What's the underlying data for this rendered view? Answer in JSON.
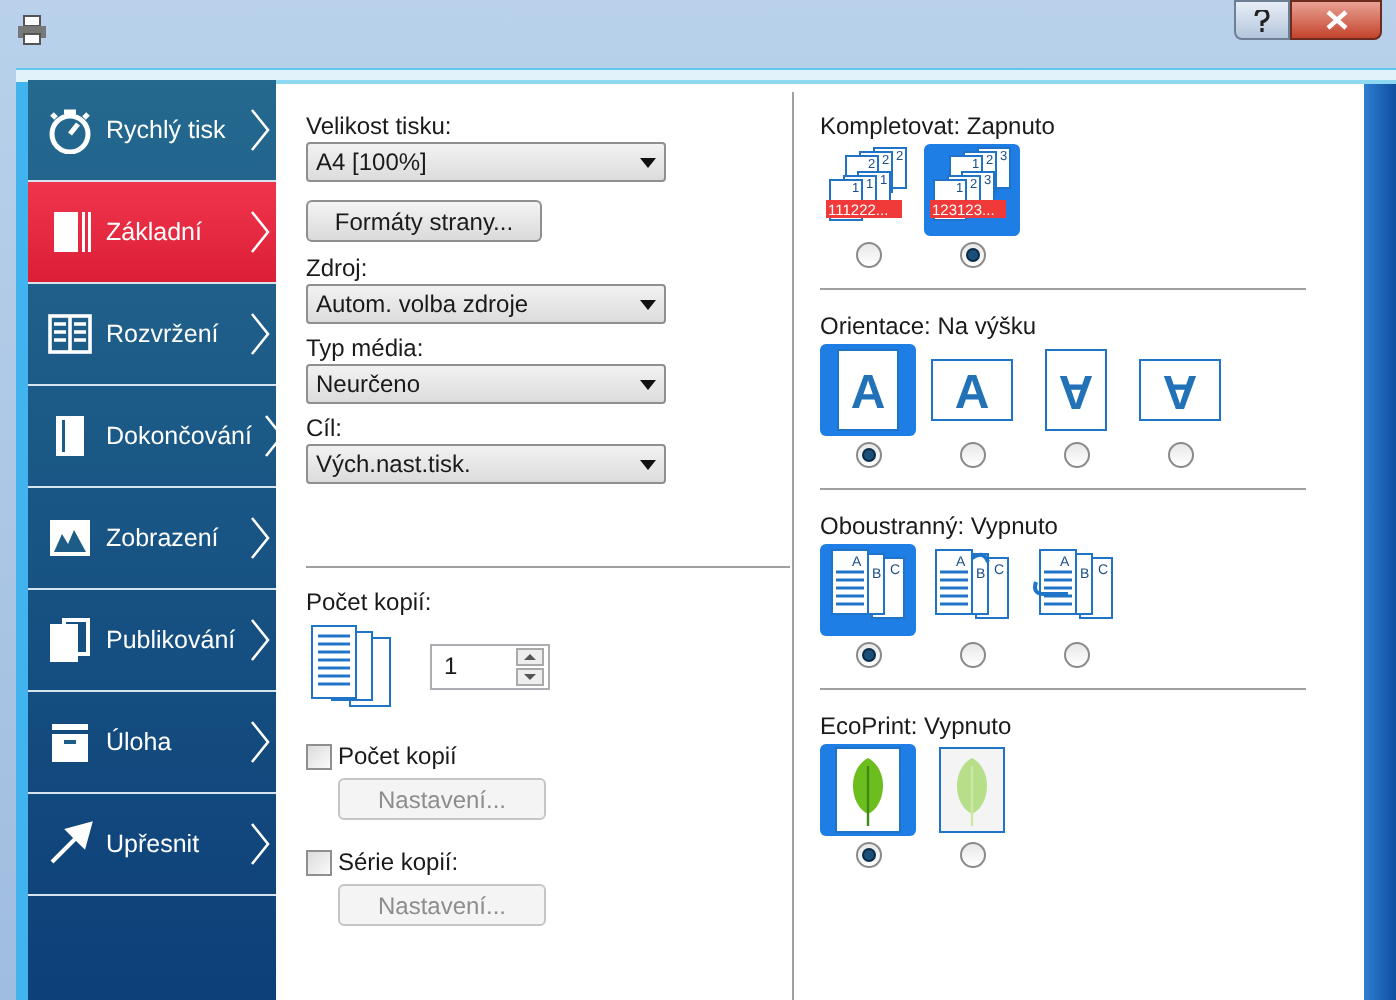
{
  "sidebar": {
    "items": [
      {
        "label": "Rychlý tisk",
        "selected": false
      },
      {
        "label": "Základní",
        "selected": true
      },
      {
        "label": "Rozvržení",
        "selected": false
      },
      {
        "label": "Dokončování",
        "selected": false
      },
      {
        "label": "Zobrazení",
        "selected": false
      },
      {
        "label": "Publikování",
        "selected": false
      },
      {
        "label": "Úloha",
        "selected": false
      },
      {
        "label": "Upřesnit",
        "selected": false
      }
    ]
  },
  "left": {
    "print_size": {
      "label": "Velikost tisku:",
      "value": "A4  [100%]"
    },
    "page_formats_button": "Formáty strany...",
    "source": {
      "label": "Zdroj:",
      "value": "Autom. volba zdroje"
    },
    "media_type": {
      "label": "Typ média:",
      "value": "Neurčeno"
    },
    "destination": {
      "label": "Cíl:",
      "value": "Vých.nast.tisk."
    },
    "copies": {
      "label": "Počet kopií:",
      "value": "1"
    },
    "options": [
      {
        "label": "Počet kopií",
        "checked": false,
        "button": {
          "label": "Nastavení...",
          "disabled": true
        }
      },
      {
        "label": "Série kopií:",
        "checked": false,
        "button": {
          "label": "Nastavení...",
          "disabled": true
        }
      }
    ]
  },
  "right": {
    "sections": [
      {
        "label": "Kompletovat:",
        "value": "Zapnuto",
        "options": [
          {
            "kind": "collate",
            "selected": false,
            "back": [
              "2",
              "2",
              "2"
            ],
            "front": [
              "1",
              "1",
              "1"
            ],
            "caption": "111222..."
          },
          {
            "kind": "collate",
            "selected": true,
            "back": [
              "1",
              "2",
              "3"
            ],
            "front": [
              "1",
              "2",
              "3"
            ],
            "caption": "123123..."
          }
        ]
      },
      {
        "label": "Orientace:",
        "value": "Na výšku",
        "options": [
          {
            "kind": "portrait",
            "selected": true,
            "letter": "A"
          },
          {
            "kind": "landscape",
            "selected": false,
            "letter": "A"
          },
          {
            "kind": "portrait_rotated",
            "selected": false,
            "letter": "A"
          },
          {
            "kind": "landscape_rotated",
            "selected": false,
            "letter": "A"
          }
        ]
      },
      {
        "label": "Oboustranný:",
        "value": "Vypnuto",
        "options": [
          {
            "kind": "simplex",
            "selected": true,
            "letters": [
              "A",
              "B",
              "C"
            ]
          },
          {
            "kind": "duplex_long",
            "selected": false,
            "letters": [
              "A",
              "B",
              "C"
            ]
          },
          {
            "kind": "duplex_short",
            "selected": false,
            "letters": [
              "A",
              "B",
              "C"
            ]
          }
        ]
      },
      {
        "label": "EcoPrint:",
        "value": "Vypnuto",
        "options": [
          {
            "kind": "leaf",
            "selected": true
          },
          {
            "kind": "leaf_pale",
            "selected": false
          }
        ]
      }
    ]
  }
}
